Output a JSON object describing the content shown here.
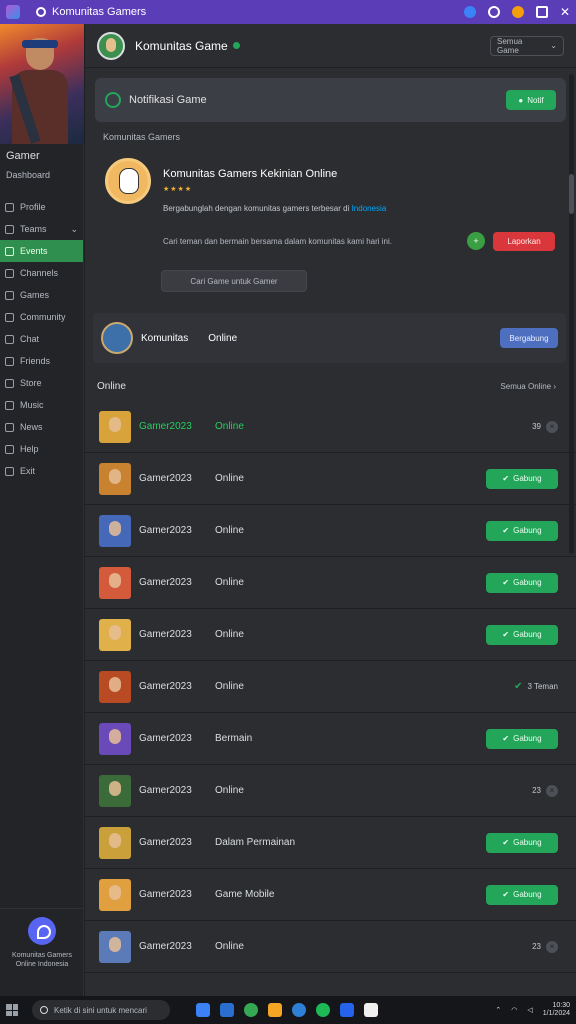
{
  "titlebar": {
    "title": "Komunitas Gamers"
  },
  "sidebar": {
    "username": "Gamer",
    "subtitle": "Dashboard",
    "items": [
      {
        "label": "Profile",
        "icon": "user-icon"
      },
      {
        "label": "Teams",
        "icon": "team-icon",
        "chevron": true
      },
      {
        "label": "Events",
        "icon": "calendar-icon",
        "active": true
      },
      {
        "label": "Channels",
        "icon": "hash-icon"
      },
      {
        "label": "Games",
        "icon": "controller-icon"
      },
      {
        "label": "Community",
        "icon": "people-icon"
      },
      {
        "label": "Chat",
        "icon": "chat-icon"
      },
      {
        "label": "Friends",
        "icon": "friends-icon"
      },
      {
        "label": "Store",
        "icon": "store-icon"
      },
      {
        "label": "Music",
        "icon": "music-icon"
      },
      {
        "label": "News",
        "icon": "news-icon"
      },
      {
        "label": "Help",
        "icon": "help-icon"
      },
      {
        "label": "Exit",
        "icon": "exit-icon"
      }
    ],
    "bottom_text": "Komunitas Gamers Online Indonesia"
  },
  "header": {
    "title": "Komunitas Game",
    "dropdown": "Semua Game"
  },
  "game_card": {
    "title": "Notifikasi Game",
    "button": "Notif"
  },
  "profile": {
    "section_label": "Komunitas Gamers",
    "name": "Komunitas Gamers Kekinian Online",
    "stars": "★★★★",
    "description": "Bergabunglah dengan komunitas gamers terbesar di",
    "link": "Indonesia",
    "info": "Cari teman dan bermain bersama dalam komunitas kami hari ini.",
    "like_label": "+",
    "red_button": "Laporkan",
    "tag_button": "Cari Game untuk Gamer"
  },
  "featured": {
    "name": "Komunitas",
    "status": "Online",
    "button": "Bergabung"
  },
  "list": {
    "title": "Online",
    "right": "Semua Online",
    "rows": [
      {
        "name": "Gamer2023",
        "status": "Online",
        "highlight": true,
        "action": {
          "type": "count",
          "value": "39"
        },
        "color": "#d7a33a"
      },
      {
        "name": "Gamer2023",
        "status": "Online",
        "action": {
          "type": "button",
          "value": "Gabung"
        },
        "color": "#c9822f"
      },
      {
        "name": "Gamer2023",
        "status": "Online",
        "action": {
          "type": "button",
          "value": "Gabung"
        },
        "color": "#4568b8"
      },
      {
        "name": "Gamer2023",
        "status": "Online",
        "action": {
          "type": "button",
          "value": "Gabung"
        },
        "color": "#d45a3c"
      },
      {
        "name": "Gamer2023",
        "status": "Online",
        "action": {
          "type": "button",
          "value": "Gabung"
        },
        "color": "#e0b04a"
      },
      {
        "name": "Gamer2023",
        "status": "Online",
        "action": {
          "type": "check",
          "value": "3 Teman"
        },
        "color": "#b84a24"
      },
      {
        "name": "Gamer2023",
        "status": "Bermain",
        "action": {
          "type": "button",
          "value": "Gabung"
        },
        "color": "#6a4ab8"
      },
      {
        "name": "Gamer2023",
        "status": "Online",
        "action": {
          "type": "count",
          "value": "23"
        },
        "color": "#3c6b3a"
      },
      {
        "name": "Gamer2023",
        "status": "Dalam Permainan",
        "action": {
          "type": "button",
          "value": "Gabung"
        },
        "color": "#c9a03a"
      },
      {
        "name": "Gamer2023",
        "status": "Game Mobile",
        "action": {
          "type": "button",
          "value": "Gabung"
        },
        "color": "#e0a040"
      },
      {
        "name": "Gamer2023",
        "status": "Online",
        "action": {
          "type": "count",
          "value": "23"
        },
        "color": "#5a7ab8"
      }
    ]
  },
  "taskbar": {
    "search": "Ketik di sini untuk mencari",
    "time": "10:30",
    "date": "1/1/2024"
  }
}
